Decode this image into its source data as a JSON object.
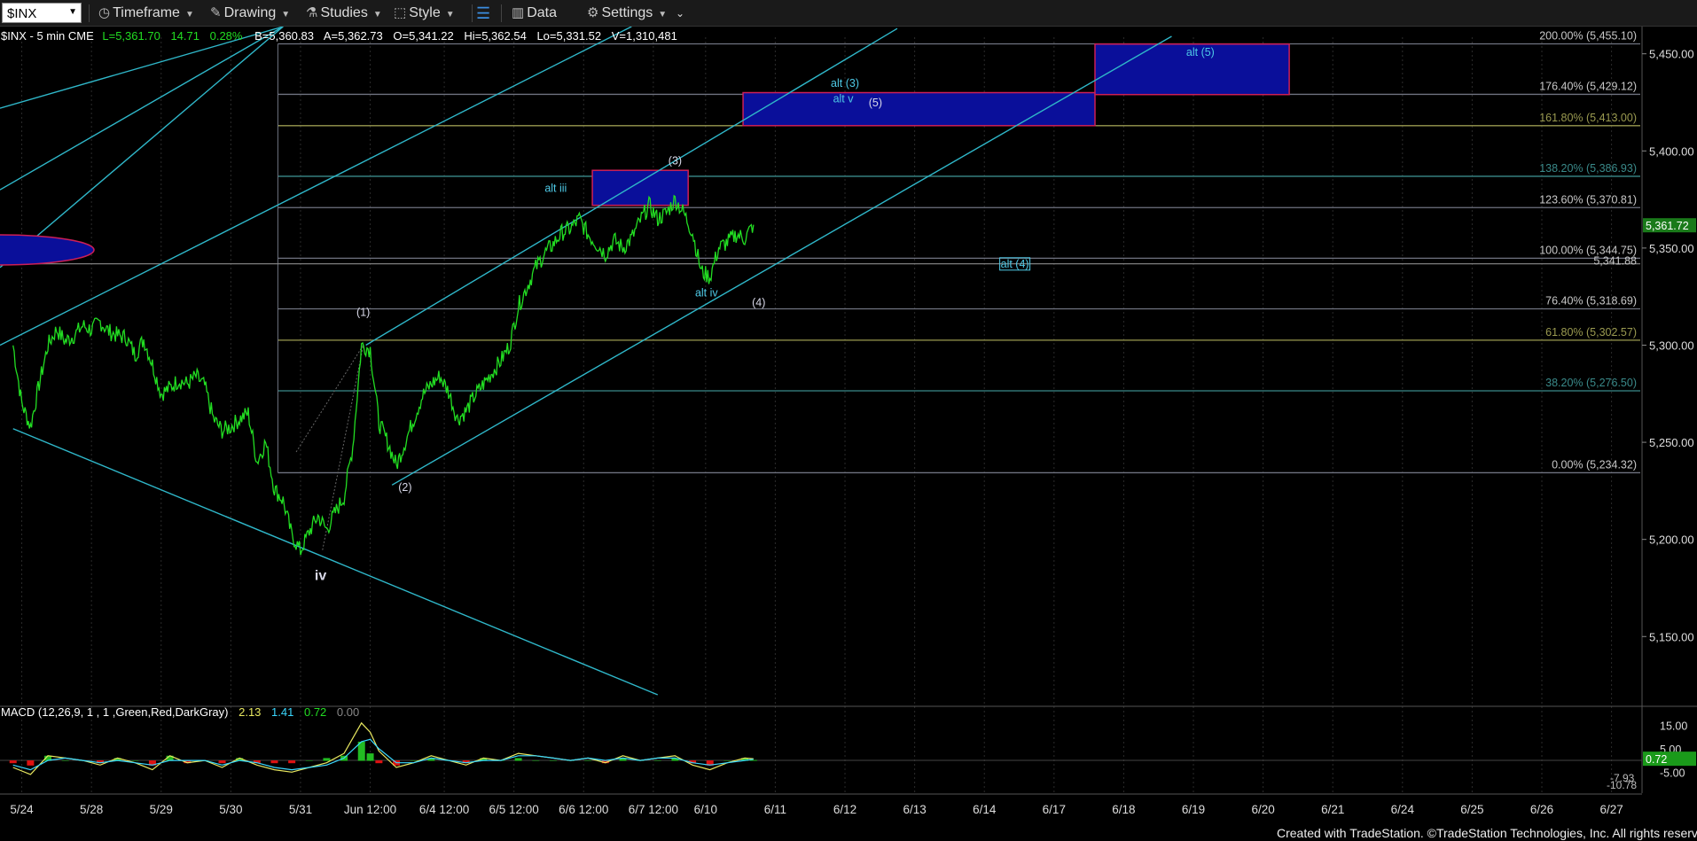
{
  "toolbar": {
    "symbol": "$INX",
    "timeframe": "Timeframe",
    "drawing": "Drawing",
    "studies": "Studies",
    "style": "Style",
    "data": "Data",
    "settings": "Settings"
  },
  "quote_line": {
    "symbol_info": "$INX - 5 min  CME",
    "last": "L=5,361.70",
    "change": "14.71",
    "pct": "0.28%",
    "bid": "B=5,360.83",
    "ask": "A=5,362.73",
    "open": "O=5,341.22",
    "high": "Hi=5,362.54",
    "low": "Lo=5,331.52",
    "volume": "V=1,310,481"
  },
  "macd_line": {
    "label": "MACD (12,26,9, 1 , 1 ,Green,Red,DarkGray)",
    "v1": "2.13",
    "v2": "1.41",
    "v3": "0.72",
    "v4": "0.00"
  },
  "footer": "Created with TradeStation. ©TradeStation Technologies, Inc. All rights reserved.",
  "colors": {
    "price": "#22dd22",
    "channel": "#2fb7c9",
    "box_fill": "#0a0f9a",
    "box_border": "#cc1f57",
    "fib_line": "#6f7380",
    "fib_gold": "#9a9a50",
    "fib_teal": "#3a8a8a",
    "wave_label": "#4ec9e6",
    "axis_text": "#dddddd"
  },
  "chart_data": {
    "type": "line",
    "price_axis": {
      "ylim": [
        5115,
        5464
      ],
      "ticks": [
        5150,
        5200,
        5250,
        5300,
        5350,
        5400,
        5450
      ],
      "tick_labels": [
        "5,150.00",
        "5,200.00",
        "5,250.00",
        "5,300.00",
        "5,350.00",
        "5,400.00",
        "5,450.00"
      ]
    },
    "time_axis": {
      "ticks": [
        {
          "t": 1,
          "label": "5/24"
        },
        {
          "t": 9,
          "label": "5/28"
        },
        {
          "t": 17,
          "label": "5/29"
        },
        {
          "t": 25,
          "label": "5/30"
        },
        {
          "t": 33,
          "label": "5/31"
        },
        {
          "t": 41,
          "label": "Jun 12:00"
        },
        {
          "t": 49.5,
          "label": "6/4 12:00"
        },
        {
          "t": 57.5,
          "label": "6/5 12:00"
        },
        {
          "t": 65.5,
          "label": "6/6 12:00"
        },
        {
          "t": 73.5,
          "label": "6/7 12:00"
        },
        {
          "t": 79.5,
          "label": "6/10"
        },
        {
          "t": 87.5,
          "label": "6/11"
        },
        {
          "t": 95.5,
          "label": "6/12"
        },
        {
          "t": 103.5,
          "label": "6/13"
        },
        {
          "t": 111.5,
          "label": "6/14"
        },
        {
          "t": 119.5,
          "label": "6/17"
        },
        {
          "t": 127.5,
          "label": "6/18"
        },
        {
          "t": 135.5,
          "label": "6/19"
        },
        {
          "t": 143.5,
          "label": "6/20"
        },
        {
          "t": 151.5,
          "label": "6/21"
        },
        {
          "t": 159.5,
          "label": "6/24"
        },
        {
          "t": 167.5,
          "label": "6/25"
        },
        {
          "t": 175.5,
          "label": "6/26"
        },
        {
          "t": 183.5,
          "label": "6/27"
        }
      ],
      "xlim": [
        -1.5,
        187
      ]
    },
    "price_series": {
      "name": "$INX",
      "t": [
        0,
        1,
        2,
        3,
        4,
        5,
        6,
        7,
        8,
        9,
        10,
        11,
        12,
        13,
        14,
        15,
        16,
        17,
        18,
        19,
        20,
        21,
        22,
        23,
        24,
        25,
        26,
        27,
        28,
        29,
        30,
        31,
        32,
        33,
        34,
        35,
        36,
        37,
        38,
        39,
        40,
        41,
        42,
        43,
        44,
        45,
        46,
        47,
        48,
        49,
        50,
        51,
        52,
        53,
        54,
        55,
        56,
        57,
        58,
        59,
        60,
        61,
        62,
        63,
        64,
        65,
        66,
        67,
        68,
        69,
        70,
        71,
        72,
        73,
        74,
        75,
        76,
        77,
        78,
        79,
        80,
        81,
        82,
        83,
        84,
        85
      ],
      "v": [
        5300,
        5270,
        5258,
        5280,
        5300,
        5308,
        5302,
        5305,
        5310,
        5308,
        5312,
        5307,
        5305,
        5304,
        5295,
        5303,
        5290,
        5275,
        5278,
        5282,
        5280,
        5284,
        5279,
        5262,
        5256,
        5258,
        5262,
        5265,
        5240,
        5250,
        5226,
        5220,
        5202,
        5194,
        5204,
        5212,
        5205,
        5214,
        5222,
        5248,
        5300,
        5298,
        5260,
        5250,
        5238,
        5250,
        5262,
        5274,
        5280,
        5284,
        5276,
        5262,
        5266,
        5274,
        5280,
        5286,
        5292,
        5300,
        5320,
        5330,
        5340,
        5347,
        5352,
        5358,
        5360,
        5365,
        5357,
        5352,
        5347,
        5354,
        5350,
        5355,
        5364,
        5372,
        5365,
        5368,
        5375,
        5368,
        5358,
        5338,
        5335,
        5350,
        5353,
        5357,
        5355,
        5362
      ]
    },
    "fib_levels": [
      {
        "pct": "200.00%",
        "price": 5455.1,
        "label": "200.00% (5,455.10)",
        "color": "#6f7380"
      },
      {
        "pct": "176.40%",
        "price": 5429.12,
        "label": "176.40% (5,429.12)",
        "color": "#6f7380"
      },
      {
        "pct": "161.80%",
        "price": 5413.0,
        "label": "161.80% (5,413.00)",
        "color": "#9a9a50"
      },
      {
        "pct": "138.20%",
        "price": 5386.93,
        "label": "138.20% (5,386.93)",
        "color": "#3a8a8a"
      },
      {
        "pct": "123.60%",
        "price": 5370.81,
        "label": "123.60% (5,370.81)",
        "color": "#6f7380"
      },
      {
        "pct": "100.00%",
        "price": 5344.75,
        "label": "100.00% (5,344.75)",
        "color": "#6f7380"
      },
      {
        "pct": "76.40%",
        "price": 5318.69,
        "label": "76.40% (5,318.69)",
        "color": "#6f7380"
      },
      {
        "pct": "61.80%",
        "price": 5302.57,
        "label": "61.80% (5,302.57)",
        "color": "#9a9a50"
      },
      {
        "pct": "38.20%",
        "price": 5276.5,
        "label": "38.20% (5,276.50)",
        "color": "#3a8a8a"
      },
      {
        "pct": "0.00%",
        "price": 5234.32,
        "label": "0.00% (5,234.32)",
        "color": "#6f7380"
      }
    ],
    "hline_extra": {
      "price": 5341.88,
      "label": "5,341.88"
    },
    "last_price": {
      "price": 5361.72,
      "label": "5,361.72"
    },
    "target_boxes": [
      {
        "t0": 66.5,
        "t1": 77.5,
        "p0": 5372,
        "p1": 5390
      },
      {
        "t0": 83.8,
        "t1": 124.2,
        "p0": 5413,
        "p1": 5430
      },
      {
        "t0": 124.2,
        "t1": 146.5,
        "p0": 5429,
        "p1": 5455
      }
    ],
    "channel_lines": [
      {
        "t0": 0,
        "p0": 5257,
        "t1": 74,
        "p1": 5120
      },
      {
        "t0": 43.5,
        "p0": 5228,
        "t1": 133,
        "p1": 5459
      },
      {
        "t0": 40.5,
        "p0": 5300,
        "t1": 101.5,
        "p1": 5463
      },
      {
        "t0": -1.5,
        "p0": 5340,
        "t1": 31,
        "p1": 5464
      },
      {
        "t0": -1.5,
        "p0": 5300,
        "t1": 71,
        "p1": 5464
      },
      {
        "t0": -1.5,
        "p0": 5380,
        "t1": 31,
        "p1": 5464
      },
      {
        "t0": -1.5,
        "p0": 5422,
        "t1": 31,
        "p1": 5464
      }
    ],
    "wave_labels": [
      {
        "text": "iv",
        "t": 35.3,
        "p": 5179,
        "big": true
      },
      {
        "text": "(1)",
        "t": 40.2,
        "p": 5315
      },
      {
        "text": "(2)",
        "t": 45,
        "p": 5225
      },
      {
        "text": "(3)",
        "t": 76,
        "p": 5393
      },
      {
        "text": "(4)",
        "t": 85.6,
        "p": 5320
      },
      {
        "text": "(5)",
        "t": 99,
        "p": 5423
      },
      {
        "text": "alt iii",
        "t": 62.3,
        "p": 5379
      },
      {
        "text": "alt iv",
        "t": 79.6,
        "p": 5325
      },
      {
        "text": "alt (3)",
        "t": 95.5,
        "p": 5433
      },
      {
        "text": "alt v",
        "t": 95.3,
        "p": 5425
      },
      {
        "text": "alt (4)",
        "t": 115,
        "p": 5340,
        "boxed": true
      },
      {
        "text": "alt (5)",
        "t": 136.3,
        "p": 5449
      }
    ],
    "macd": {
      "ylim": [
        -14,
        22
      ],
      "ticks": [
        {
          "v": 15,
          "label": "15.00"
        },
        {
          "v": 5,
          "label": "5.00"
        },
        {
          "v": -5,
          "label": "-5.00"
        }
      ],
      "macd_value": {
        "v": 0.72,
        "label": "0.72"
      },
      "extra_labels": [
        "-7.93",
        "-10.78"
      ],
      "t": [
        0,
        2,
        4,
        6,
        8,
        10,
        12,
        14,
        16,
        18,
        20,
        22,
        24,
        26,
        28,
        30,
        32,
        34,
        36,
        38,
        40,
        41,
        42,
        44,
        46,
        48,
        50,
        52,
        54,
        56,
        58,
        60,
        62,
        64,
        66,
        68,
        70,
        72,
        74,
        76,
        78,
        80,
        82,
        84,
        85
      ],
      "line1": [
        -3,
        -6,
        2,
        1,
        0,
        -2,
        1,
        -1,
        -4,
        2,
        -1,
        0,
        -3,
        1,
        -2,
        -4,
        -5,
        -3,
        -1,
        3,
        16,
        12,
        4,
        -3,
        -1,
        2,
        0,
        -2,
        1,
        0,
        3,
        2,
        1,
        0,
        1,
        -1,
        2,
        0,
        1,
        2,
        -2,
        -4,
        -1,
        1,
        0.7
      ],
      "line2": [
        -2,
        -4,
        0,
        1,
        0,
        -1,
        0,
        -1,
        -2,
        0,
        0,
        0,
        -2,
        0,
        -1,
        -3,
        -4,
        -3,
        -2,
        1,
        8,
        9,
        5,
        -1,
        -1,
        1,
        0,
        -1,
        0,
        0,
        2,
        2,
        1,
        0,
        1,
        0,
        1,
        0,
        1,
        1,
        -1,
        -2,
        -1,
        0,
        0.5
      ]
    }
  }
}
